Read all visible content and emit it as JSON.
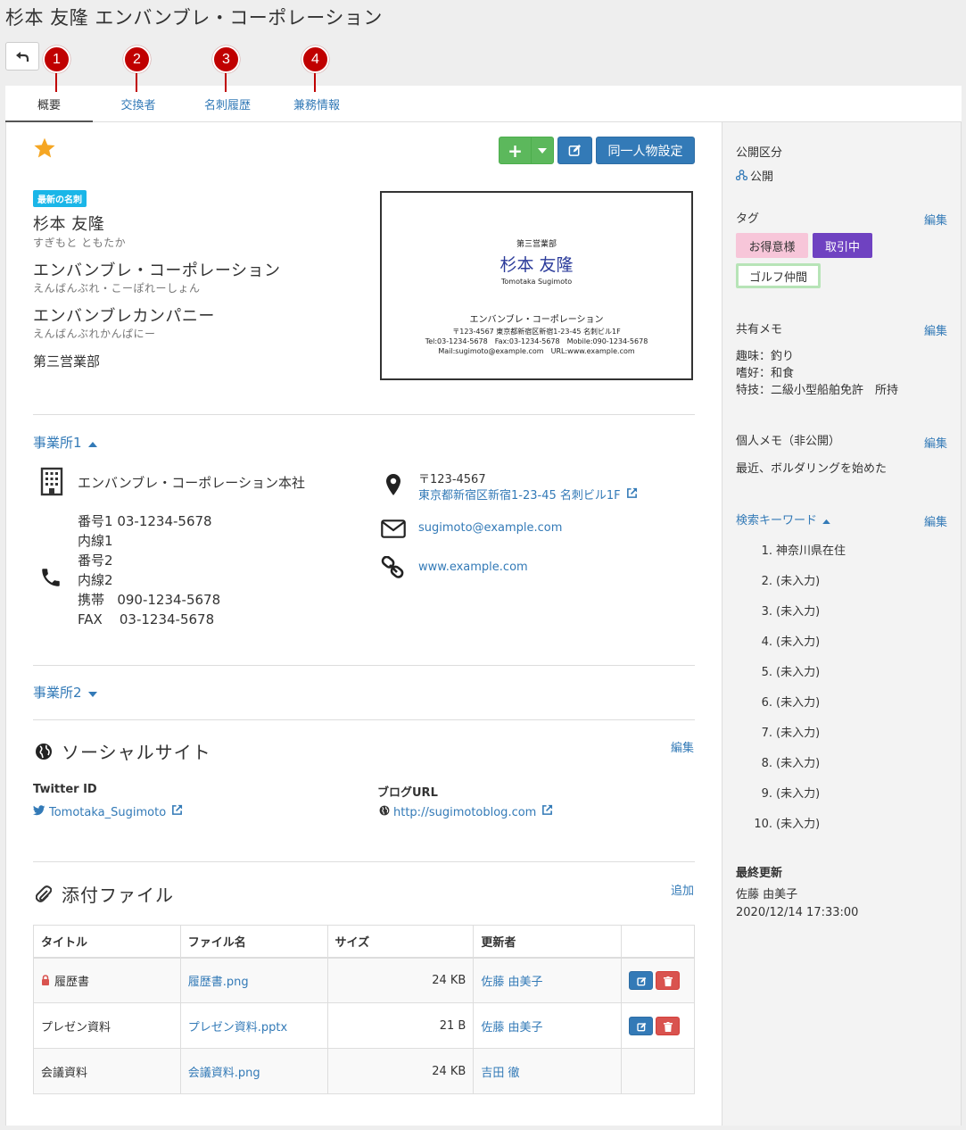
{
  "page": {
    "title": "杉本 友隆 エンバンブレ・コーポレーション"
  },
  "tabs": [
    {
      "label": "概要",
      "badge": "1"
    },
    {
      "label": "交換者",
      "badge": "2"
    },
    {
      "label": "名刺履歴",
      "badge": "3"
    },
    {
      "label": "兼務情報",
      "badge": "4"
    }
  ],
  "toolbar": {
    "add_label": "+",
    "same_person_label": "同一人物設定"
  },
  "profile": {
    "latest_badge": "最新の名刺",
    "name": "杉本 友隆",
    "name_kana": "すぎもと ともたか",
    "company": "エンバンブレ・コーポレーション",
    "company_kana": "えんばんぶれ・こーぽれーしょん",
    "company2": "エンバンブレカンパニー",
    "company2_kana": "えんばんぶれかんぱにー",
    "department": "第三営業部"
  },
  "card": {
    "department": "第三営業部",
    "name": "杉本 友隆",
    "name_roman": "Tomotaka Sugimoto",
    "company": "エンバンブレ・コーポレーション",
    "address": "〒123-4567 東京都新宿区新宿1-23-45 名刺ビル1F",
    "phones": "Tel:03-1234-5678　Fax:03-1234-5678　Mobile:090-1234-5678",
    "mail_url": "Mail:sugimoto@example.com　URL:www.example.com"
  },
  "office1": {
    "heading": "事業所1",
    "name": "エンバンブレ・コーポレーション本社",
    "phones": [
      {
        "label": "番号1",
        "value": "03-1234-5678"
      },
      {
        "label": "内線1",
        "value": ""
      },
      {
        "label": "番号2",
        "value": ""
      },
      {
        "label": "内線2",
        "value": ""
      },
      {
        "label": "携帯",
        "value": "090-1234-5678"
      },
      {
        "label": "FAX",
        "value": "03-1234-5678"
      }
    ],
    "postal": "〒123-4567",
    "address": "東京都新宿区新宿1-23-45 名刺ビル1F",
    "email": "sugimoto@example.com",
    "url": "www.example.com"
  },
  "office2": {
    "heading": "事業所2"
  },
  "social": {
    "heading": "ソーシャルサイト",
    "edit": "編集",
    "twitter_label": "Twitter ID",
    "twitter_value": "Tomotaka_Sugimoto",
    "blog_label": "ブログURL",
    "blog_value": "http://sugimotoblog.com"
  },
  "attachments": {
    "heading": "添付ファイル",
    "add": "追加",
    "columns": [
      "タイトル",
      "ファイル名",
      "サイズ",
      "更新者"
    ],
    "rows": [
      {
        "title": "履歴書",
        "file": "履歴書.png",
        "size": "24 KB",
        "updater": "佐藤 由美子",
        "locked": true,
        "actions": true
      },
      {
        "title": "プレゼン資料",
        "file": "プレゼン資料.pptx",
        "size": "21 B",
        "updater": "佐藤 由美子",
        "locked": false,
        "actions": true
      },
      {
        "title": "会議資料",
        "file": "会議資料.png",
        "size": "24 KB",
        "updater": "吉田 徹",
        "locked": false,
        "actions": false
      }
    ]
  },
  "sidebar": {
    "visibility_label": "公開区分",
    "visibility_value": "公開",
    "tags_label": "タグ",
    "tags_edit": "編集",
    "tags": [
      {
        "label": "お得意様",
        "bg": "#f7c6d9",
        "fg": "#333333"
      },
      {
        "label": "取引中",
        "bg": "#6f42c1",
        "fg": "#ffffff"
      },
      {
        "label": "ゴルフ仲間",
        "bg": "#ffffff",
        "fg": "#333333",
        "border": "#b7e4b7"
      }
    ],
    "shared_memo_label": "共有メモ",
    "shared_memo_edit": "編集",
    "shared_memo_lines": [
      "趣味：釣り",
      "嗜好：和食",
      "特技：二級小型船舶免許　所持"
    ],
    "private_memo_label": "個人メモ（非公開）",
    "private_memo_edit": "編集",
    "private_memo": "最近、ボルダリングを始めた",
    "keywords_label": "検索キーワード",
    "keywords_edit": "編集",
    "keywords": [
      "神奈川県在住",
      "(未入力)",
      "(未入力)",
      "(未入力)",
      "(未入力)",
      "(未入力)",
      "(未入力)",
      "(未入力)",
      "(未入力)",
      "(未入力)"
    ],
    "updated_label": "最終更新",
    "updated_by": "佐藤 由美子",
    "updated_at": "2020/12/14 17:33:00"
  },
  "colors": {
    "link": "#337ab7",
    "badge_red": "#c00000",
    "star": "#f5a623",
    "green": "#5cb85c",
    "blue": "#337ab7",
    "red": "#d9534f"
  }
}
